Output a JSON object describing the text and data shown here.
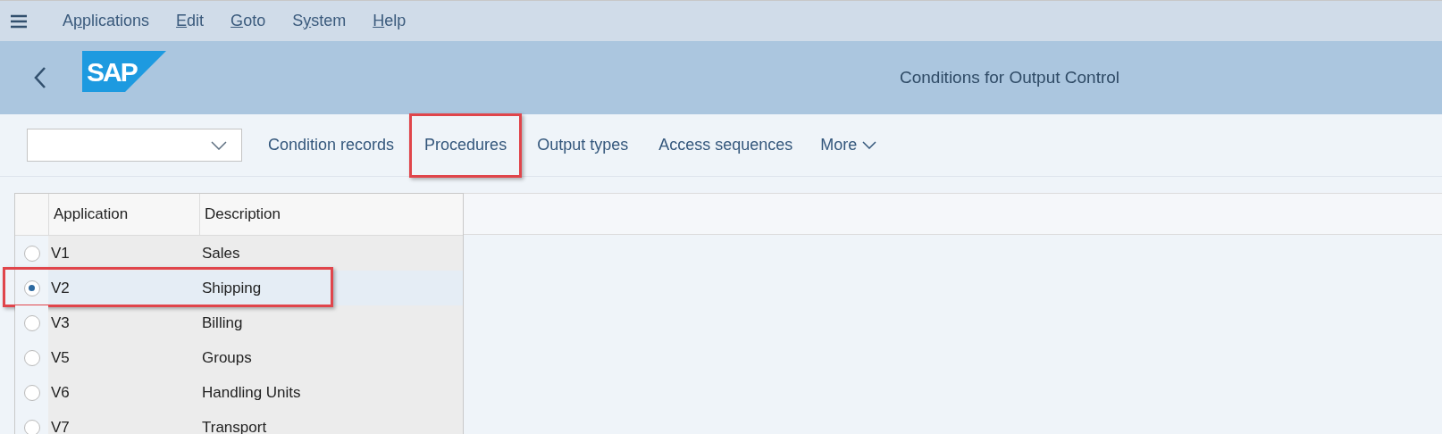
{
  "menu_bar": {
    "items": [
      {
        "before": "A",
        "mnemonic": "p",
        "after": "plications"
      },
      {
        "mnemonic": "E",
        "after": "dit"
      },
      {
        "mnemonic": "G",
        "after": "oto"
      },
      {
        "before": "S",
        "mnemonic": "y",
        "after": "stem"
      },
      {
        "mnemonic": "H",
        "after": "elp"
      }
    ]
  },
  "header": {
    "logo": "SAP",
    "title": "Conditions for Output Control"
  },
  "toolbar": {
    "items": [
      {
        "label": "Condition records",
        "highlighted": false
      },
      {
        "label": "Procedures",
        "highlighted": true
      },
      {
        "label": "Output types",
        "highlighted": false
      },
      {
        "label": "Access sequences",
        "highlighted": false
      }
    ],
    "more": "More"
  },
  "table": {
    "columns": [
      "Application",
      "Description"
    ],
    "rows": [
      {
        "cells": [
          "V1",
          "Sales"
        ],
        "selected": false,
        "highlighted": false
      },
      {
        "cells": [
          "V2",
          "Shipping"
        ],
        "selected": true,
        "highlighted": true
      },
      {
        "cells": [
          "V3",
          "Billing"
        ],
        "selected": false,
        "highlighted": false
      },
      {
        "cells": [
          "V5",
          "Groups"
        ],
        "selected": false,
        "highlighted": false
      },
      {
        "cells": [
          "V6",
          "Handling Units"
        ],
        "selected": false,
        "highlighted": false
      },
      {
        "cells": [
          "V7",
          "Transport"
        ],
        "selected": false,
        "highlighted": false
      }
    ]
  }
}
